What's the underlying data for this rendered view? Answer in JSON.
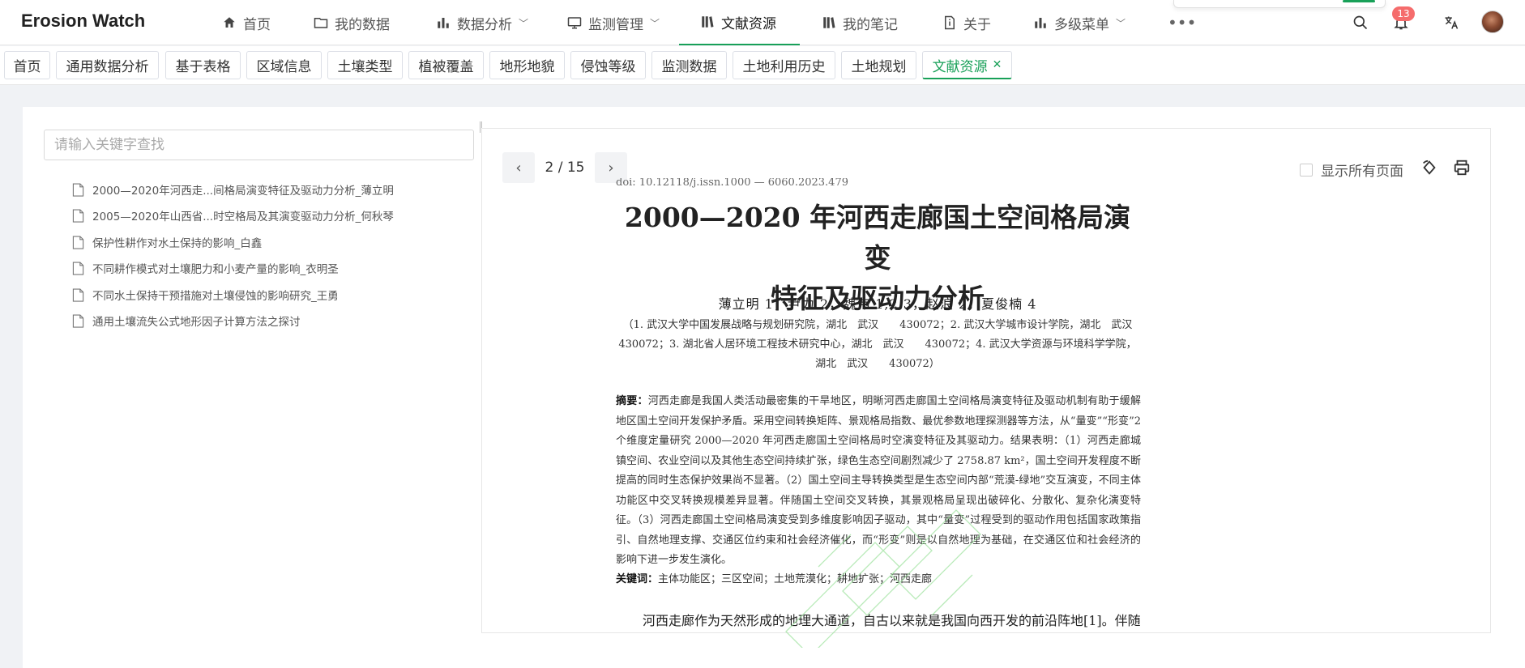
{
  "header": {
    "brand": "Erosion Watch",
    "nav": [
      {
        "label": "首页",
        "icon": "home-icon"
      },
      {
        "label": "我的数据",
        "icon": "folder-icon"
      },
      {
        "label": "数据分析",
        "icon": "bar-chart-icon",
        "dropdown": true
      },
      {
        "label": "监测管理",
        "icon": "monitor-icon",
        "dropdown": true
      },
      {
        "label": "文献资源",
        "icon": "library-icon",
        "active": true
      },
      {
        "label": "我的笔记",
        "icon": "notebook-icon"
      },
      {
        "label": "关于",
        "icon": "info-icon"
      },
      {
        "label": "多级菜单",
        "icon": "bar-chart-icon",
        "dropdown": true
      }
    ],
    "more_icon": "more-icon",
    "notification_count": "13"
  },
  "tabs": [
    {
      "label": "首页"
    },
    {
      "label": "通用数据分析"
    },
    {
      "label": "基于表格"
    },
    {
      "label": "区域信息"
    },
    {
      "label": "土壤类型"
    },
    {
      "label": "植被覆盖"
    },
    {
      "label": "地形地貌"
    },
    {
      "label": "侵蚀等级"
    },
    {
      "label": "监测数据"
    },
    {
      "label": "土地利用历史"
    },
    {
      "label": "土地规划"
    },
    {
      "label": "文献资源",
      "active": true,
      "closable": true
    }
  ],
  "sidebar": {
    "search_placeholder": "请输入关键字查找",
    "files": [
      "2000—2020年河西走...间格局演变特征及驱动力分析_薄立明",
      "2005—2020年山西省...时空格局及其演变驱动力分析_何秋琴",
      "保护性耕作对水土保持的影响_白鑫",
      "不同耕作模式对土壤肥力和小麦产量的影响_衣明圣",
      "不同水土保持干预措施对土壤侵蚀的影响研究_王勇",
      "通用土壤流失公式地形因子计算方法之探讨"
    ]
  },
  "viewer": {
    "page_indicator": "2 / 15",
    "show_all_label": "显示所有页面",
    "document": {
      "doi": "doi: 10.12118/j.issn.1000 — 6060.2023.479",
      "title_line1": "2000—2020 年河西走廊国土空间格局演变",
      "title_line2": "特征及驱动力分析",
      "authors": "薄立明 1，尹力 2，魏伟 1,2,3，赵浪 2，夏俊楠 4",
      "affiliation": "（1. 武汉大学中国发展战略与规划研究院，湖北　武汉　　430072；2. 武汉大学城市设计学院，湖北　武汉　　430072；3. 湖北省人居环境工程技术研究中心，湖北　武汉　　430072；4. 武汉大学资源与环境科学学院，湖北　武汉　　430072）",
      "abstract_label": "摘要：",
      "abstract": "河西走廊是我国人类活动最密集的干旱地区，明晰河西走廊国土空间格局演变特征及驱动机制有助于缓解地区国土空间开发保护矛盾。采用空间转换矩阵、景观格局指数、最优参数地理探测器等方法，从“量变”“形变”2 个维度定量研究 2000—2020 年河西走廊国土空间格局时空演变特征及其驱动力。结果表明：（1）河西走廊城镇空间、农业空间以及其他生态空间持续扩张，绿色生态空间剧烈减少了 2758.87 km²，国土空间开发程度不断提高的同时生态保护效果尚不显著。（2）国土空间主导转换类型是生态空间内部“荒漠-绿地”交互演变，不同主体功能区中交叉转换规模差异显著。伴随国土空间交叉转换，其景观格局呈现出破碎化、分散化、复杂化演变特征。（3）河西走廊国土空间格局演变受到多维度影响因子驱动，其中“量变”过程受到的驱动作用包括国家政策指引、自然地理支撑、交通区位约束和社会经济催化，而“形变”则是以自然地理为基础，在交通区位和社会经济的影响下进一步发生演化。",
      "keywords_label": "关键词：",
      "keywords": "主体功能区；三区空间；土地荒漠化；耕地扩张；河西走廊",
      "body_start": "河西走廊作为天然形成的地理大通道，自古以来就是我国向西开发的前沿阵地[1]。伴随"
    }
  },
  "colors": {
    "accent": "#18a058",
    "badge": "#f56c6c"
  }
}
